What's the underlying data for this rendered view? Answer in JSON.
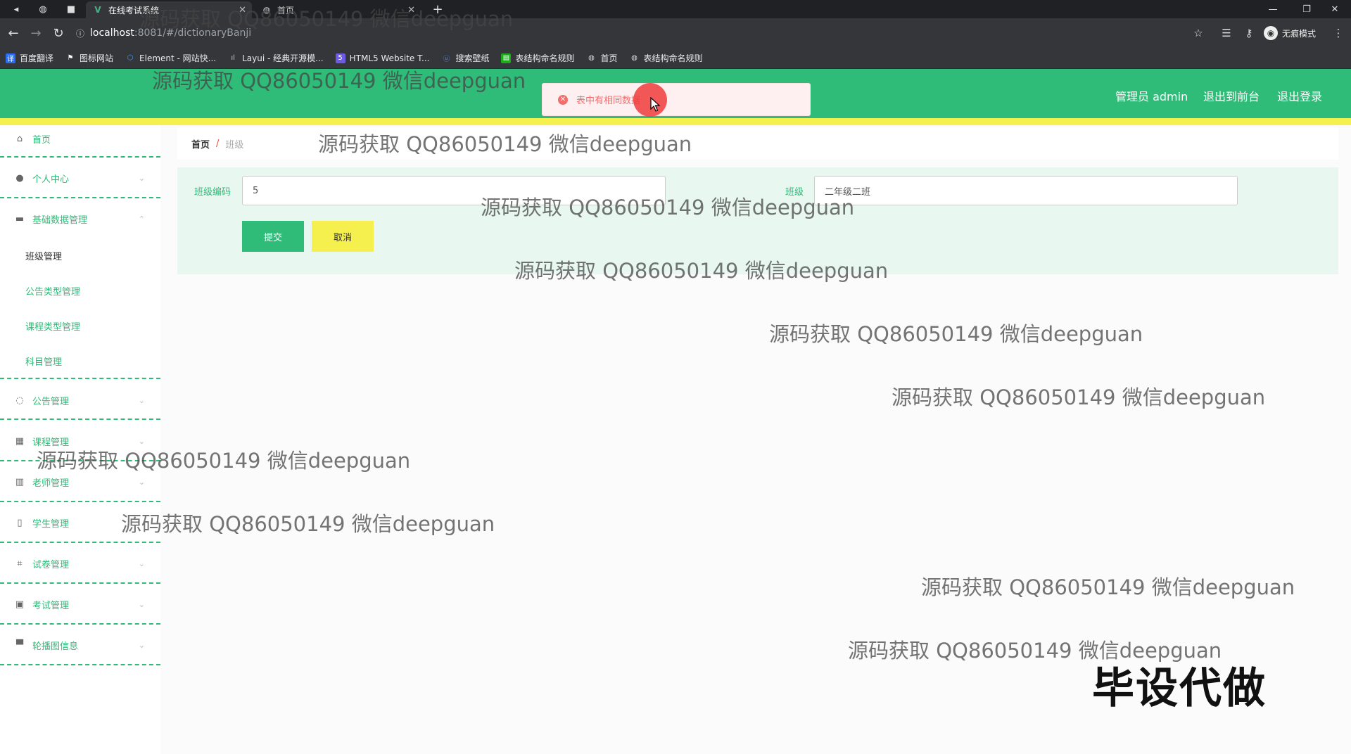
{
  "browser": {
    "tabs": [
      {
        "title": "在线考试系统",
        "active": true
      },
      {
        "title": "首页",
        "active": false
      }
    ],
    "url_host": "localhost",
    "url_rest": ":8081/#/dictionaryBanji",
    "incognito_label": "无痕模式",
    "bookmarks": [
      {
        "label": "百度翻译",
        "color": "#2a6df4"
      },
      {
        "label": "图标网站",
        "color": "#ffffff"
      },
      {
        "label": "Element - 网站快...",
        "color": "#409eff"
      },
      {
        "label": "Layui - 经典开源模...",
        "color": "#666666"
      },
      {
        "label": "HTML5 Website T...",
        "color": "#6b5be6"
      },
      {
        "label": "搜索壁纸",
        "color": "#2a6df4"
      },
      {
        "label": "表结构命名规则",
        "color": "#1aad19"
      },
      {
        "label": "首页",
        "color": "#cccccc"
      },
      {
        "label": "表结构命名规则",
        "color": "#cccccc"
      }
    ]
  },
  "header": {
    "admin_label": "管理员 admin",
    "to_front_label": "退出到前台",
    "logout_label": "退出登录"
  },
  "toast": {
    "message": "表中有相同数据"
  },
  "sidebar": {
    "home": "首页",
    "personal": "个人中心",
    "basic": "基础数据管理",
    "basic_sub": [
      "班级管理",
      "公告类型管理",
      "课程类型管理",
      "科目管理"
    ],
    "notice": "公告管理",
    "course": "课程管理",
    "teacher": "老师管理",
    "student": "学生管理",
    "paper": "试卷管理",
    "exam": "考试管理",
    "carousel": "轮播图信息"
  },
  "breadcrumb": {
    "home": "首页",
    "current": "班级"
  },
  "form": {
    "code_label": "班级编码",
    "code_value": "5",
    "class_label": "班级",
    "class_value": "二年级二班",
    "submit_label": "提交",
    "cancel_label": "取消"
  },
  "watermark": {
    "text": "源码获取 QQ86050149 微信deepguan",
    "big_text": "毕设代做"
  },
  "colors": {
    "primary": "#2ebc78",
    "accent_yellow": "#f6f04f",
    "error": "#f56c6c"
  }
}
